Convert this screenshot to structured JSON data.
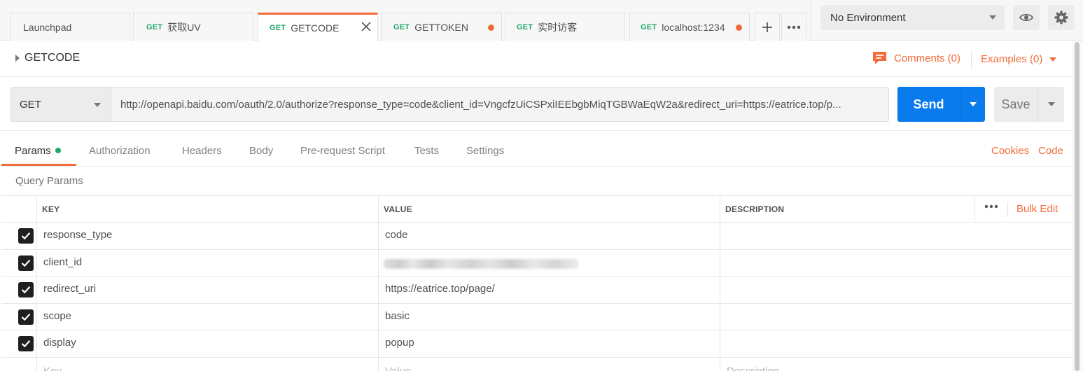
{
  "tabs": [
    {
      "method": "",
      "name": "Launchpad",
      "dirty": false,
      "active": false
    },
    {
      "method": "GET",
      "name": "获取UV",
      "dirty": false,
      "active": false
    },
    {
      "method": "GET",
      "name": "GETCODE",
      "dirty": false,
      "active": true
    },
    {
      "method": "GET",
      "name": "GETTOKEN",
      "dirty": true,
      "active": false
    },
    {
      "method": "GET",
      "name": "实时访客",
      "dirty": false,
      "active": false
    },
    {
      "method": "GET",
      "name": "localhost:1234",
      "dirty": true,
      "active": false
    }
  ],
  "tab_actions": {
    "add_icon": "plus-icon",
    "more_icon": "more-horizontal-icon"
  },
  "environment": {
    "selected": "No Environment",
    "view_icon": "eye-icon",
    "settings_icon": "gear-icon"
  },
  "request": {
    "title": "GETCODE",
    "comments_label": "Comments (0)",
    "examples_label": "Examples (0)",
    "method": "GET",
    "url": "http://openapi.baidu.com/oauth/2.0/authorize?response_type=code&client_id=VngcfzUiCSPxiIEEbgbMiqTGBWaEqW2a&redirect_uri=https://eatrice.top/p...",
    "send_label": "Send",
    "save_label": "Save"
  },
  "request_tabs": [
    {
      "label": "Params",
      "active": true,
      "has_dot": true
    },
    {
      "label": "Authorization",
      "active": false
    },
    {
      "label": "Headers",
      "active": false
    },
    {
      "label": "Body",
      "active": false
    },
    {
      "label": "Pre-request Script",
      "active": false
    },
    {
      "label": "Tests",
      "active": false
    },
    {
      "label": "Settings",
      "active": false
    }
  ],
  "request_links": {
    "cookies": "Cookies",
    "code": "Code"
  },
  "params": {
    "section_title": "Query Params",
    "columns": {
      "key": "KEY",
      "value": "VALUE",
      "description": "DESCRIPTION"
    },
    "bulk_edit": "Bulk Edit",
    "rows": [
      {
        "checked": true,
        "key": "response_type",
        "value": "code",
        "description": ""
      },
      {
        "checked": true,
        "key": "client_id",
        "value": "",
        "description": "",
        "value_redacted": true
      },
      {
        "checked": true,
        "key": "redirect_uri",
        "value": "https://eatrice.top/page/",
        "description": ""
      },
      {
        "checked": true,
        "key": "scope",
        "value": "basic",
        "description": ""
      },
      {
        "checked": true,
        "key": "display",
        "value": "popup",
        "description": ""
      }
    ],
    "new_row_placeholders": {
      "key": "Key",
      "value": "Value",
      "description": "Description"
    }
  },
  "colors": {
    "accent": "#f26b3a",
    "send": "#097bed",
    "get_method": "#20a768"
  }
}
